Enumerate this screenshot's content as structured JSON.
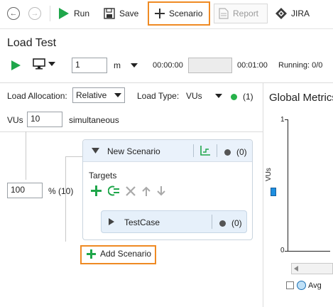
{
  "toolbar": {
    "run_label": "Run",
    "save_label": "Save",
    "scenario_label": "Scenario",
    "report_label": "Report",
    "jira_label": "JIRA"
  },
  "page_title": "Load Test",
  "run_bar": {
    "duration_value": "1",
    "unit_value": "m",
    "elapsed_time": "00:00:00",
    "total_time": "00:01:00",
    "running_label": "Running: 0/0"
  },
  "settings": {
    "load_allocation_label": "Load Allocation:",
    "load_allocation_value": "Relative",
    "load_type_label": "Load Type:",
    "load_type_value": "VUs",
    "status_count": "(1)",
    "vus_label": "VUs",
    "vus_value": "10",
    "simultaneous_label": "simultaneous"
  },
  "allocation": {
    "percent_value": "100",
    "percent_suffix": "% (10)"
  },
  "scenario_card": {
    "name": "New Scenario",
    "count": "(0)",
    "targets_label": "Targets",
    "testcase": {
      "name": "TestCase",
      "count": "(0)"
    }
  },
  "add_scenario_label": "Add Scenario",
  "metrics": {
    "title": "Global Metrics",
    "y_max_label": "1",
    "y_min_label": "0",
    "y_axis_label": "VUs",
    "legend_avg": "Avg"
  },
  "colors": {
    "run_green": "#1fa64a",
    "highlight_orange": "#ef8a23",
    "status_green": "#27b24a",
    "vus_blue": "#1e8fe0",
    "card_header_bg": "#eaf2fb"
  }
}
